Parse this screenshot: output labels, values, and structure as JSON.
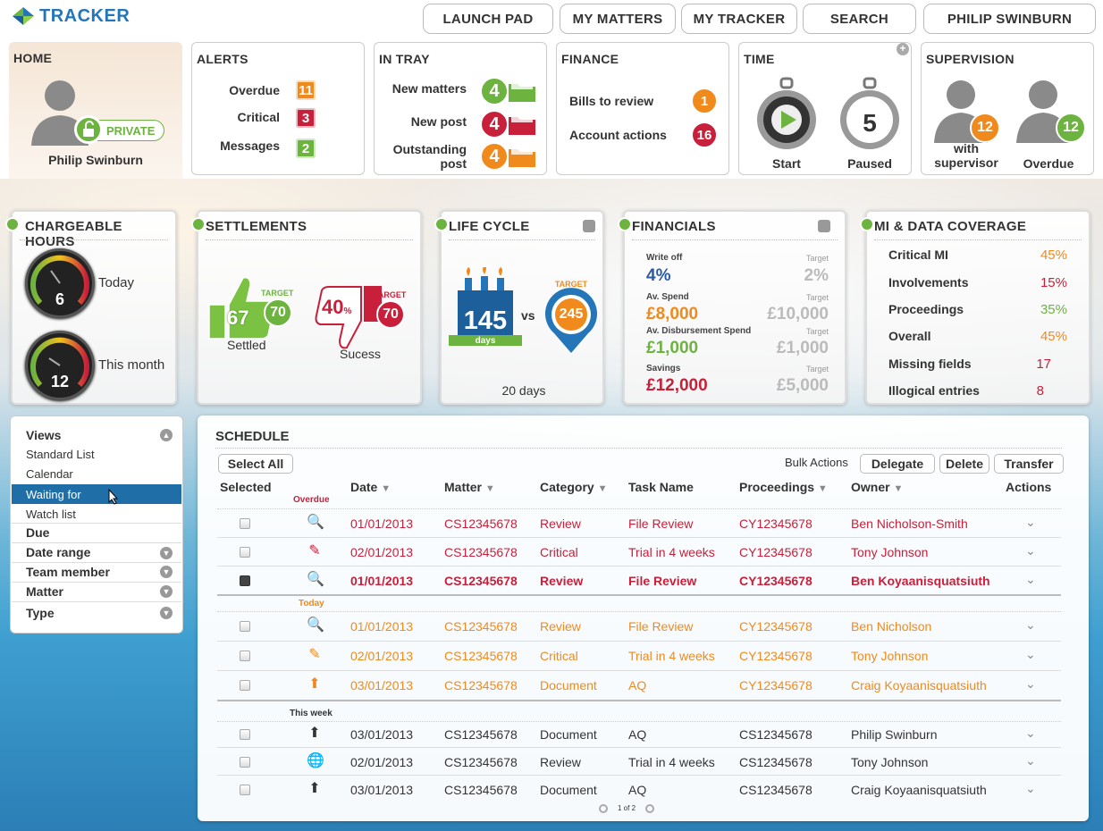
{
  "app": {
    "logo": "TRACKER"
  },
  "nav": [
    "LAUNCH PAD",
    "MY MATTERS",
    "MY TRACKER",
    "SEARCH",
    "PHILIP SWINBURN"
  ],
  "home": {
    "title": "HOME",
    "user": "Philip Swinburn",
    "badge": "PRIVATE"
  },
  "alerts": {
    "title": "ALERTS",
    "items": [
      {
        "label": "Overdue",
        "count": "11",
        "color": "#f08a1c"
      },
      {
        "label": "Critical",
        "count": "3",
        "color": "#c8203a"
      },
      {
        "label": "Messages",
        "count": "2",
        "color": "#6cb33f"
      }
    ]
  },
  "intray": {
    "title": "IN TRAY",
    "items": [
      {
        "label": "New matters",
        "count": "4",
        "color": "#6cb33f"
      },
      {
        "label": "New post",
        "count": "4",
        "color": "#c8203a"
      },
      {
        "label": "Outstanding post",
        "count": "4",
        "color": "#f08a1c"
      }
    ]
  },
  "finance": {
    "title": "FINANCE",
    "items": [
      {
        "label": "Bills to review",
        "count": "1",
        "color": "#f08a1c"
      },
      {
        "label": "Account actions",
        "count": "16",
        "color": "#c8203a"
      }
    ]
  },
  "time": {
    "title": "TIME",
    "start": "Start",
    "paused_label": "Paused",
    "paused_count": "5"
  },
  "supervision": {
    "title": "SUPERVISION",
    "with_label": "with supervisor",
    "with_count": "12",
    "overdue_label": "Overdue",
    "overdue_count": "12"
  },
  "chargeable": {
    "title": "CHARGEABLE HOURS",
    "today_label": "Today",
    "today_value": "6",
    "month_label": "This month",
    "month_value": "12"
  },
  "settlements": {
    "title": "SETTLEMENTS",
    "settled_value": "67",
    "settled_target": "70",
    "settled_label": "Settled",
    "success_value": "40",
    "success_unit": "%",
    "success_target": "70",
    "success_label": "Sucess",
    "target_word": "TARGET"
  },
  "lifecycle": {
    "title": "LIFE CYCLE",
    "days_value": "145",
    "days_unit": "days",
    "vs": "vs",
    "target_value": "245",
    "target_word": "TARGET",
    "footer": "20 days"
  },
  "financials": {
    "title": "FINANCIALS",
    "target_word": "Target",
    "rows": [
      {
        "label": "Write off",
        "value": "4%",
        "target": "2%",
        "color": "#2c5aa0"
      },
      {
        "label": "Av. Spend",
        "value": "£8,000",
        "target": "£10,000",
        "color": "#f08a1c"
      },
      {
        "label": "Av. Disbursement Spend",
        "value": "£1,000",
        "target": "£1,000",
        "color": "#6cb33f"
      },
      {
        "label": "Savings",
        "value": "£12,000",
        "target": "£5,000",
        "color": "#c8203a"
      }
    ]
  },
  "mi": {
    "title": "MI & DATA COVERAGE",
    "rows": [
      {
        "label": "Critical MI",
        "value": "45%",
        "color": "#f08a1c"
      },
      {
        "label": "Involvements",
        "value": "15%",
        "color": "#c8203a"
      },
      {
        "label": "Proceedings",
        "value": "35%",
        "color": "#6cb33f"
      },
      {
        "label": "Overall",
        "value": "45%",
        "color": "#f08a1c"
      },
      {
        "label": "Missing fields",
        "value": "17",
        "color": "#c8203a"
      },
      {
        "label": "Illogical entries",
        "value": "8",
        "color": "#c8203a"
      }
    ]
  },
  "views": {
    "title": "Views",
    "items": [
      "Standard List",
      "Calendar",
      "Waiting for",
      "Watch list"
    ],
    "filters": [
      "Due",
      "Date range",
      "Team member",
      "Matter",
      "Type"
    ]
  },
  "schedule": {
    "title": "SCHEDULE",
    "select_all": "Select All",
    "bulk_actions": "Bulk Actions",
    "bulk_buttons": [
      "Delegate",
      "Delete",
      "Transfer"
    ],
    "headers": [
      "Selected",
      "Date",
      "Matter",
      "Category",
      "Task Name",
      "Proceedings",
      "Owner",
      "Actions"
    ],
    "groups": {
      "overdue": "Overdue",
      "today": "Today",
      "week": "This week"
    },
    "rows": [
      {
        "icon": "search-icon",
        "date": "01/01/2013",
        "matter": "CS12345678",
        "category": "Review",
        "task": "File Review",
        "proceedings": "CY12345678",
        "owner": "Ben Nicholson-Smith",
        "color": "#c8203a"
      },
      {
        "icon": "pencil-icon",
        "date": "02/01/2013",
        "matter": "CS12345678",
        "category": "Critical",
        "task": "Trial in 4 weeks",
        "proceedings": "CY12345678",
        "owner": "Tony Johnson",
        "color": "#c8203a"
      },
      {
        "icon": "search-icon",
        "date": "01/01/2013",
        "matter": "CS12345678",
        "category": "Review",
        "task": "File Review",
        "proceedings": "CY12345678",
        "owner": "Ben Koyaanisquatsiuth",
        "color": "#c8203a"
      },
      {
        "icon": "search-icon",
        "date": "01/01/2013",
        "matter": "CS12345678",
        "category": "Review",
        "task": "File Review",
        "proceedings": "CY12345678",
        "owner": "Ben Nicholson",
        "color": "#f08a1c"
      },
      {
        "icon": "pencil-icon",
        "date": "02/01/2013",
        "matter": "CS12345678",
        "category": "Critical",
        "task": "Trial in 4 weeks",
        "proceedings": "CY12345678",
        "owner": "Tony Johnson",
        "color": "#f08a1c"
      },
      {
        "icon": "upload-icon",
        "date": "03/01/2013",
        "matter": "CS12345678",
        "category": "Document",
        "task": "AQ",
        "proceedings": "CY12345678",
        "owner": "Craig Koyaanisquatsiuth",
        "color": "#f08a1c"
      },
      {
        "icon": "upload-icon",
        "date": "03/01/2013",
        "matter": "CS12345678",
        "category": "Document",
        "task": "AQ",
        "proceedings": "CS12345678",
        "owner": "Philip Swinburn",
        "color": "#333333"
      },
      {
        "icon": "globe-icon",
        "date": "02/01/2013",
        "matter": "CS12345678",
        "category": "Review",
        "task": "Trial in 4 weeks",
        "proceedings": "CS12345678",
        "owner": "Tony Johnson",
        "color": "#333333"
      },
      {
        "icon": "upload-icon",
        "date": "03/01/2013",
        "matter": "CS12345678",
        "category": "Document",
        "task": "AQ",
        "proceedings": "CS12345678",
        "owner": "Craig Koyaanisquatsiuth",
        "color": "#333333"
      }
    ],
    "pager": "1 of 2"
  }
}
